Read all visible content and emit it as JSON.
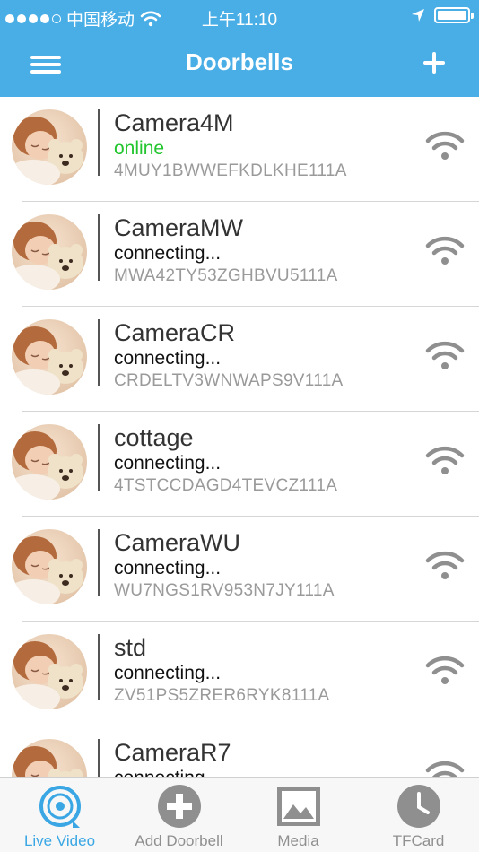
{
  "status_bar": {
    "carrier": "中国移动",
    "time": "上午11:10"
  },
  "nav": {
    "title": "Doorbells"
  },
  "devices": [
    {
      "name": "Camera4M",
      "status": "online",
      "uid": "4MUY1BWWEFKDLKHE111A"
    },
    {
      "name": "CameraMW",
      "status": "connecting...",
      "uid": "MWA42TY53ZGHBVU5111A"
    },
    {
      "name": "CameraCR",
      "status": "connecting...",
      "uid": "CRDELTV3WNWAPS9V111A"
    },
    {
      "name": "cottage",
      "status": "connecting...",
      "uid": "4TSTCCDAGD4TEVCZ111A"
    },
    {
      "name": "CameraWU",
      "status": "connecting...",
      "uid": "WU7NGS1RV953N7JY111A"
    },
    {
      "name": "std",
      "status": "connecting...",
      "uid": "ZV51PS5ZRER6RYK8111A"
    },
    {
      "name": "CameraR7",
      "status": "connecting...",
      "uid": ""
    }
  ],
  "tabs": [
    {
      "label": "Live Video",
      "icon": "live-video-icon"
    },
    {
      "label": "Add Doorbell",
      "icon": "add-circle-icon"
    },
    {
      "label": "Media",
      "icon": "picture-icon"
    },
    {
      "label": "TFCard",
      "icon": "clock-icon"
    }
  ],
  "colors": {
    "accent": "#4aaee6",
    "online": "#22c52d",
    "tab_active": "#3aa7e4",
    "tab_inactive": "#8f8f8f"
  }
}
